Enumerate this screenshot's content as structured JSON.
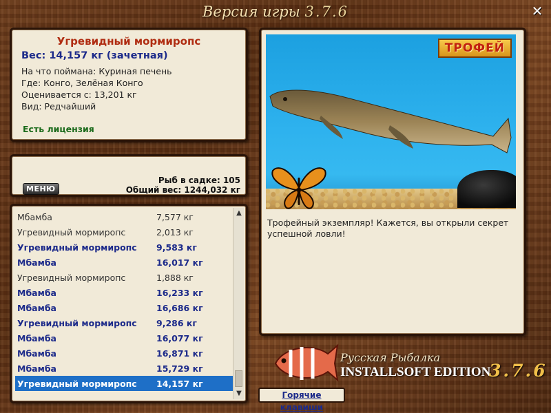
{
  "window": {
    "title_prefix": "Версия игры",
    "version": "3.7.6"
  },
  "fish_info": {
    "name": "Угревидный мормиропс",
    "weight": "Вес: 14,157 кг (зачетная)",
    "bait": "На что поймана: Куриная печень",
    "location": "Где: Конго, Зелёная Конго",
    "valued_from": "Оценивается с: 13,201 кг",
    "rarity": "Вид: Редчайший",
    "license": "Есть лицензия"
  },
  "stats": {
    "menu_label": "МЕНЮ",
    "fish_count": "Рыб в садке: 105",
    "total_weight": "Общий вес: 1244,032 кг"
  },
  "catch_list": [
    {
      "name": "Мбамба",
      "weight": "7,577 кг",
      "trophy": false
    },
    {
      "name": "Угревидный мормиропс",
      "weight": "2,013 кг",
      "trophy": false
    },
    {
      "name": "Угревидный мормиропс",
      "weight": "9,583 кг",
      "trophy": true
    },
    {
      "name": "Мбамба",
      "weight": "16,017 кг",
      "trophy": true
    },
    {
      "name": "Угревидный мормиропс",
      "weight": "1,888 кг",
      "trophy": false
    },
    {
      "name": "Мбамба",
      "weight": "16,233 кг",
      "trophy": true
    },
    {
      "name": "Мбамба",
      "weight": "16,686 кг",
      "trophy": true
    },
    {
      "name": "Угревидный мормиропс",
      "weight": "9,286 кг",
      "trophy": true
    },
    {
      "name": "Мбамба",
      "weight": "16,077 кг",
      "trophy": true
    },
    {
      "name": "Мбамба",
      "weight": "16,871 кг",
      "trophy": true
    },
    {
      "name": "Мбамба",
      "weight": "15,729 кг",
      "trophy": true
    },
    {
      "name": "Угревидный мормиропс",
      "weight": "14,157 кг",
      "trophy": true,
      "selected": true
    }
  ],
  "image_panel": {
    "trophy_badge": "ТРОФЕЙ",
    "message": "Трофейный экземпляр! Кажется, вы открыли секрет успешной ловли!"
  },
  "logo": {
    "title": "Русская Рыбалка",
    "edition": "INSTALLSOFT EDITION",
    "version": "3.7.6"
  },
  "hotkeys_label": "Горячие клавиши",
  "colors": {
    "trophy_text": "#1c2a8a",
    "fish_name": "#b02d12",
    "license": "#1a6a1a",
    "selection": "#1e6fc7"
  }
}
